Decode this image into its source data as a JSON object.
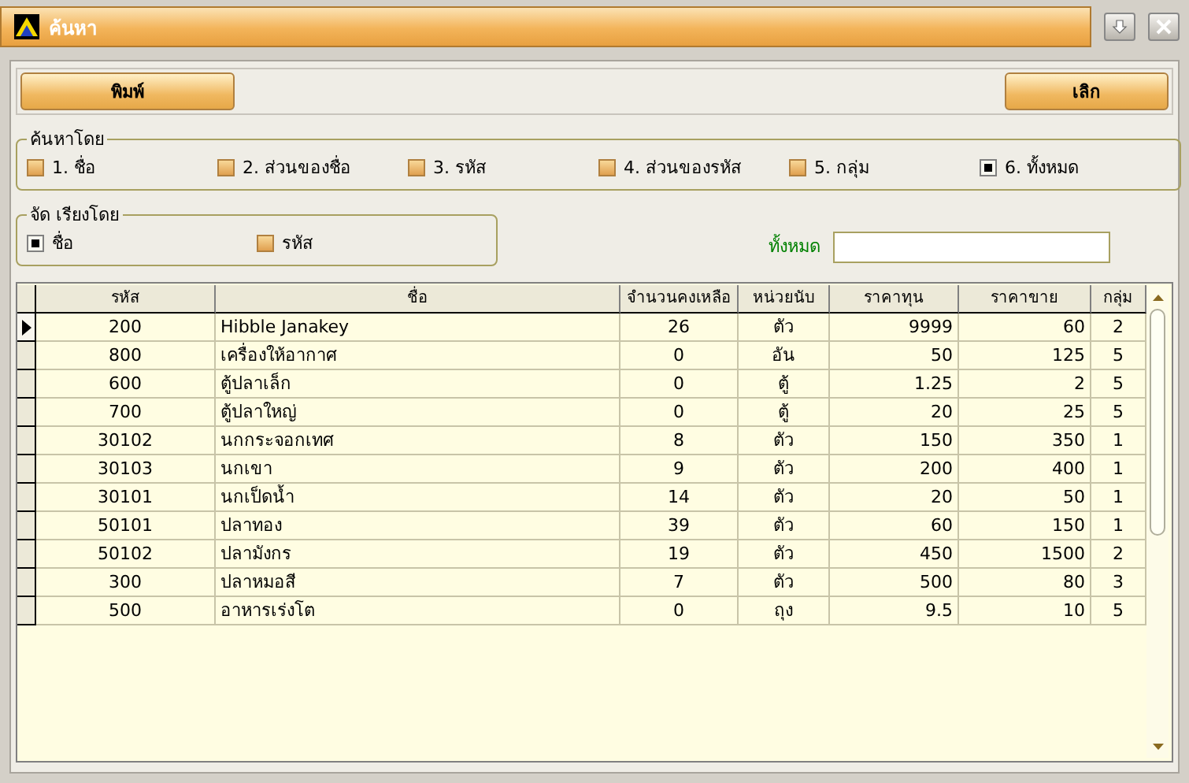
{
  "window": {
    "title": "ค้นหา"
  },
  "buttons": [
    {
      "label": "พิมพ์"
    },
    {
      "label": "เลิก"
    }
  ],
  "search_by": {
    "title": "ค้นหาโดย",
    "options": [
      {
        "label": "1. ชื่อ",
        "checked": false
      },
      {
        "label": "2. ส่วนของชื่อ",
        "checked": false
      },
      {
        "label": "3. รหัส",
        "checked": false
      },
      {
        "label": "4. ส่วนของรหัส",
        "checked": false
      },
      {
        "label": "5. กลุ่ม",
        "checked": false
      },
      {
        "label": "6. ทั้งหมด",
        "checked": true
      }
    ]
  },
  "sort_by": {
    "title": "จัด เรียงโดย",
    "options": [
      {
        "label": "ชื่อ",
        "checked": true
      },
      {
        "label": "รหัส",
        "checked": false
      }
    ]
  },
  "filter": {
    "label": "ทั้งหมด"
  },
  "table": {
    "columns": [
      "รหัส",
      "ชื่อ",
      "จำนวนคงเหลือ",
      "หน่วยนับ",
      "ราคาทุน",
      "ราคาขาย",
      "กลุ่ม"
    ],
    "rows": [
      {
        "selected": true,
        "cells": [
          "200",
          "Hibble Janakey",
          "26",
          "ตัว",
          "9999",
          "60",
          "2"
        ]
      },
      {
        "selected": false,
        "cells": [
          "800",
          "เครื่องให้อากาศ",
          "0",
          "อัน",
          "50",
          "125",
          "5"
        ]
      },
      {
        "selected": false,
        "cells": [
          "600",
          "ตู้ปลาเล็ก",
          "0",
          "ตู้",
          "1.25",
          "2",
          "5"
        ]
      },
      {
        "selected": false,
        "cells": [
          "700",
          "ตู้ปลาใหญ่",
          "0",
          "ตู้",
          "20",
          "25",
          "5"
        ]
      },
      {
        "selected": false,
        "cells": [
          "30102",
          "นกกระจอกเทศ",
          "8",
          "ตัว",
          "150",
          "350",
          "1"
        ]
      },
      {
        "selected": false,
        "cells": [
          "30103",
          "นกเขา",
          "9",
          "ตัว",
          "200",
          "400",
          "1"
        ]
      },
      {
        "selected": false,
        "cells": [
          "30101",
          "นกเป็ดน้ำ",
          "14",
          "ตัว",
          "20",
          "50",
          "1"
        ]
      },
      {
        "selected": false,
        "cells": [
          "50101",
          "ปลาทอง",
          "39",
          "ตัว",
          "60",
          "150",
          "1"
        ]
      },
      {
        "selected": false,
        "cells": [
          "50102",
          "ปลามังกร",
          "19",
          "ตัว",
          "450",
          "1500",
          "2"
        ]
      },
      {
        "selected": false,
        "cells": [
          "300",
          "ปลาหมอสี",
          "7",
          "ตัว",
          "500",
          "80",
          "3"
        ]
      },
      {
        "selected": false,
        "cells": [
          "500",
          "อาหารเร่งโต",
          "0",
          "ถุง",
          "9.5",
          "10",
          "5"
        ]
      }
    ]
  }
}
